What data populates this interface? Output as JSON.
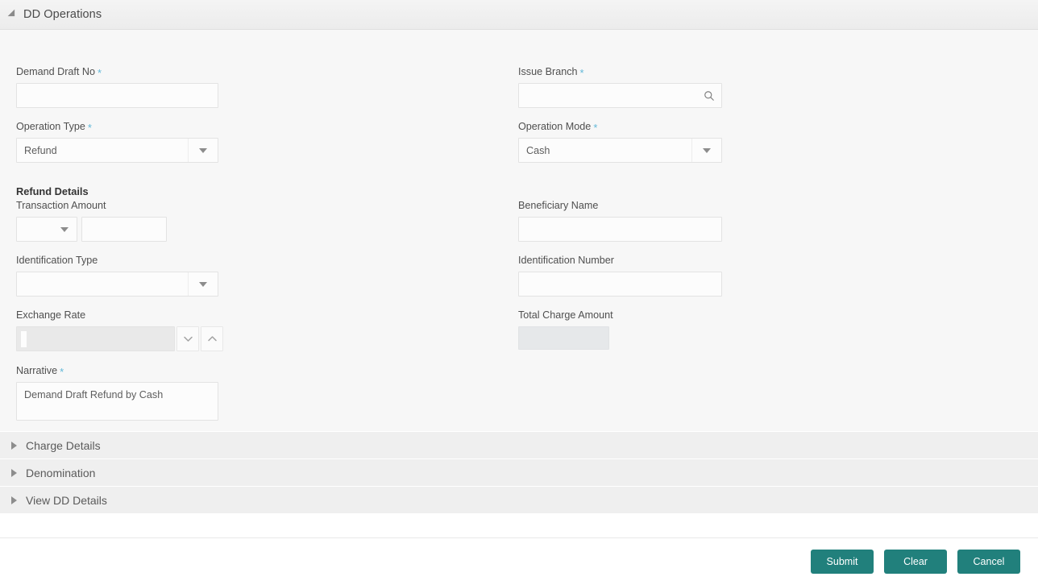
{
  "panel": {
    "title": "DD Operations",
    "expand_icon": "triangle-expanded-icon"
  },
  "form": {
    "demand_draft_no": {
      "label": "Demand Draft No",
      "required": true,
      "value": "",
      "placeholder": ""
    },
    "issue_branch": {
      "label": "Issue Branch",
      "required": true,
      "value": "",
      "placeholder": "",
      "icon": "search-icon"
    },
    "operation_type": {
      "label": "Operation Type",
      "required": true,
      "value": "Refund",
      "icon": "caret-down-icon"
    },
    "operation_mode": {
      "label": "Operation Mode",
      "required": true,
      "value": "Cash",
      "icon": "caret-down-icon"
    },
    "refund_details_title": "Refund Details",
    "transaction_amount": {
      "label": "Transaction Amount",
      "required": false,
      "currency": "",
      "amount": "",
      "icon": "caret-down-icon"
    },
    "beneficiary_name": {
      "label": "Beneficiary Name",
      "required": false,
      "value": "",
      "placeholder": ""
    },
    "identification_type": {
      "label": "Identification Type",
      "required": false,
      "value": "",
      "icon": "caret-down-icon"
    },
    "identification_number": {
      "label": "Identification Number",
      "required": false,
      "value": "",
      "placeholder": ""
    },
    "exchange_rate": {
      "label": "Exchange Rate",
      "required": false,
      "value": "",
      "disabled": true,
      "down_icon": "chevron-down-icon",
      "up_icon": "chevron-up-icon"
    },
    "total_charge_amount": {
      "label": "Total Charge Amount",
      "required": false,
      "value": "",
      "disabled": true
    },
    "narrative": {
      "label": "Narrative",
      "required": true,
      "value": "Demand Draft Refund by Cash"
    }
  },
  "sections": [
    {
      "label": "Charge Details",
      "expanded": false,
      "icon": "triangle-collapsed-icon"
    },
    {
      "label": "Denomination",
      "expanded": false,
      "icon": "triangle-collapsed-icon"
    },
    {
      "label": "View DD Details",
      "expanded": false,
      "icon": "triangle-collapsed-icon"
    }
  ],
  "footer": {
    "submit_label": "Submit",
    "clear_label": "Clear",
    "cancel_label": "Cancel"
  },
  "colors": {
    "button_teal": "#21807c",
    "required_asterisk": "#62b8d8",
    "panel_background": "#f7f7f7",
    "accordion_background": "#efefef"
  }
}
